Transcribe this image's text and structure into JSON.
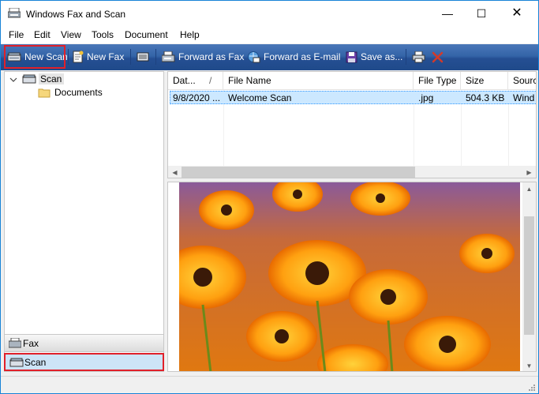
{
  "window": {
    "title": "Windows Fax and Scan"
  },
  "menu": [
    "File",
    "Edit",
    "View",
    "Tools",
    "Document",
    "Help"
  ],
  "toolbar": {
    "new_scan": "New Scan",
    "new_fax": "New Fax",
    "forward_fax": "Forward as Fax",
    "forward_email": "Forward as E-mail",
    "save_as": "Save as..."
  },
  "tree": {
    "root": "Scan",
    "child": "Documents"
  },
  "nav": {
    "fax": "Fax",
    "scan": "Scan"
  },
  "list": {
    "columns": [
      "Dat...",
      "File Name",
      "File Type",
      "Size",
      "Sourc"
    ],
    "sort_indicator": "/",
    "rows": [
      {
        "date": "9/8/2020 ...",
        "name": "Welcome Scan",
        "type": ".jpg",
        "size": "504.3 KB",
        "source": "Wind"
      }
    ]
  },
  "window_controls": {
    "minimize": "—",
    "maximize": "☐",
    "close": "✕"
  },
  "icons": [
    "scanner-icon",
    "new-fax-icon",
    "cover-page-icon",
    "forward-fax-icon",
    "forward-email-icon",
    "save-icon",
    "print-icon",
    "delete-icon",
    "folder-icon",
    "fax-icon"
  ],
  "colors": {
    "toolbar_top": "#4a77b8",
    "toolbar_bottom": "#1f4a8a",
    "selection": "#cce8ff",
    "highlight_box": "#e0202a",
    "scan_nav_bg": "#cde4f7"
  }
}
